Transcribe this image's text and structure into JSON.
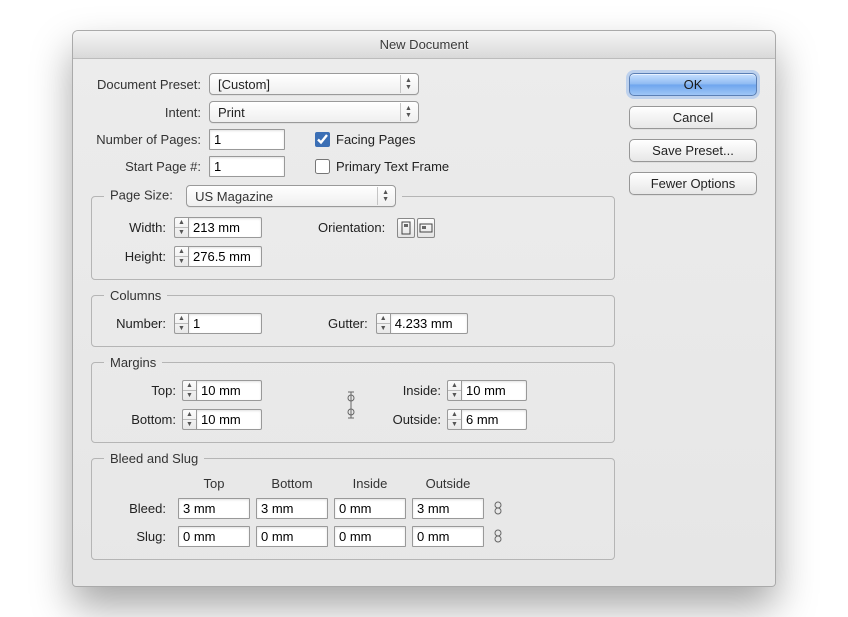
{
  "title": "New Document",
  "buttons": {
    "ok": "OK",
    "cancel": "Cancel",
    "save_preset": "Save Preset...",
    "fewer_options": "Fewer Options"
  },
  "top": {
    "document_preset_label": "Document Preset:",
    "document_preset_value": "[Custom]",
    "intent_label": "Intent:",
    "intent_value": "Print",
    "number_of_pages_label": "Number of Pages:",
    "number_of_pages_value": "1",
    "start_page_label": "Start Page #:",
    "start_page_value": "1",
    "facing_pages_label": "Facing Pages",
    "primary_text_frame_label": "Primary Text Frame"
  },
  "page_size": {
    "legend": "Page Size:",
    "preset": "US Magazine",
    "width_label": "Width:",
    "width_value": "213 mm",
    "height_label": "Height:",
    "height_value": "276.5 mm",
    "orientation_label": "Orientation:"
  },
  "columns": {
    "legend": "Columns",
    "number_label": "Number:",
    "number_value": "1",
    "gutter_label": "Gutter:",
    "gutter_value": "4.233 mm"
  },
  "margins": {
    "legend": "Margins",
    "top_label": "Top:",
    "top_value": "10 mm",
    "bottom_label": "Bottom:",
    "bottom_value": "10 mm",
    "inside_label": "Inside:",
    "inside_value": "10 mm",
    "outside_label": "Outside:",
    "outside_value": "6 mm"
  },
  "bleed_slug": {
    "legend": "Bleed and Slug",
    "headers": {
      "top": "Top",
      "bottom": "Bottom",
      "inside": "Inside",
      "outside": "Outside"
    },
    "bleed_label": "Bleed:",
    "bleed": {
      "top": "3 mm",
      "bottom": "3 mm",
      "inside": "0 mm",
      "outside": "3 mm"
    },
    "slug_label": "Slug:",
    "slug": {
      "top": "0 mm",
      "bottom": "0 mm",
      "inside": "0 mm",
      "outside": "0 mm"
    }
  }
}
